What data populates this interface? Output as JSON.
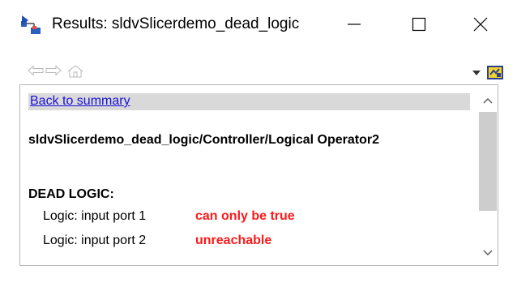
{
  "window": {
    "title": "Results: sldvSlicerdemo_dead_logic",
    "app_icon": "simulink-arrow-icon"
  },
  "controls": {
    "minimize": "minimize-icon",
    "maximize": "maximize-icon",
    "close": "close-icon"
  },
  "toolbar": {
    "back": "back-arrow-icon",
    "forward": "forward-arrow-icon",
    "home": "home-icon",
    "menu": "dropdown-arrow-icon",
    "settings": "highlight-model-icon"
  },
  "content": {
    "back_link": "Back to summary",
    "block_path": "sldvSlicerdemo_dead_logic/Controller/Logical Operator2",
    "section_heading": "DEAD LOGIC:",
    "rows": [
      {
        "label": "Logic: input port 1",
        "status": "can only be true"
      },
      {
        "label": "Logic: input port 2",
        "status": "unreachable"
      }
    ],
    "status_color": "#ff1a1a",
    "link_color": "#1a10d8"
  }
}
